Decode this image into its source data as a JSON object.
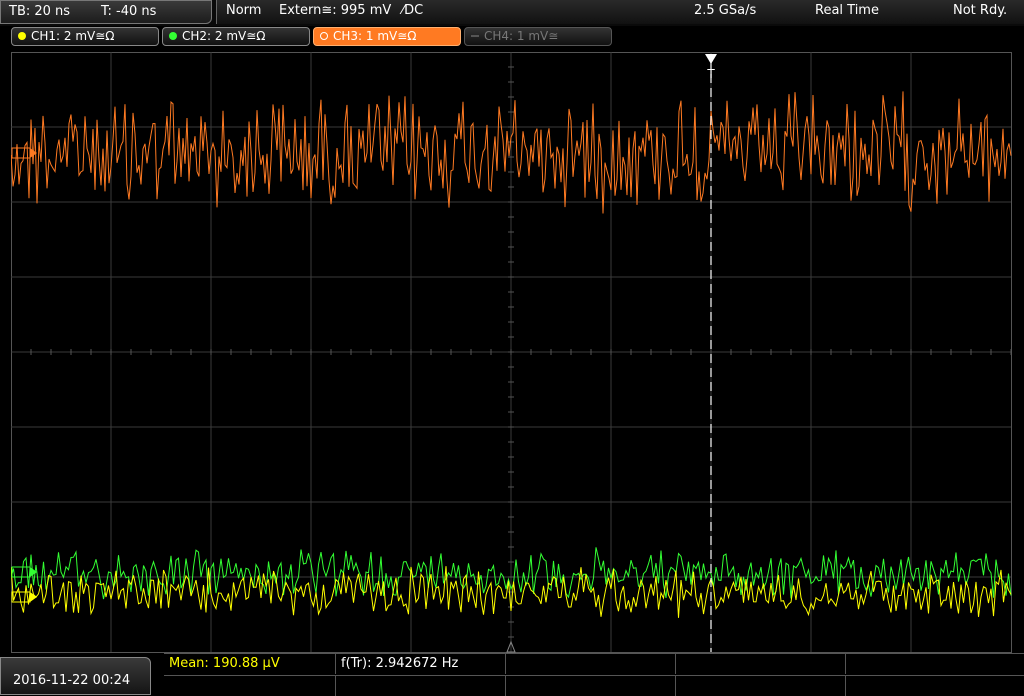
{
  "timebase": {
    "tb": "TB: 20 ns",
    "trigger_pos": "T: -40 ns"
  },
  "status": {
    "mode": "Norm",
    "trigger_source": "Extern≅: 995 mV",
    "trigger_coupling": "⁄DC",
    "sample_rate": "2.5 GSa/s",
    "acq_mode": "Real Time",
    "state": "Not Rdy."
  },
  "channels": [
    {
      "label": "CH1: 2 mV≅Ω",
      "color": "#ffff00",
      "active": true
    },
    {
      "label": "CH2: 2 mV≅Ω",
      "color": "#33ff33",
      "active": true
    },
    {
      "label": "CH3: 1 mV≅Ω",
      "color": "#ff7a22",
      "active": true,
      "selected": true
    },
    {
      "label": "CH4: 1 mV≅",
      "color": "#555555",
      "active": false
    }
  ],
  "trigger_marker_label": "T",
  "colors": {
    "grid": "#3a3a3a",
    "trigger_line": "#ffffff",
    "ch1": "#ffff00",
    "ch2": "#33ff33",
    "ch3": "#ff7a22"
  },
  "datetime": "2016-11-22 00:24",
  "measurements": {
    "mean": "Mean: 190.88 µV",
    "freq": "f(Tr): 2.942672 Hz"
  }
}
